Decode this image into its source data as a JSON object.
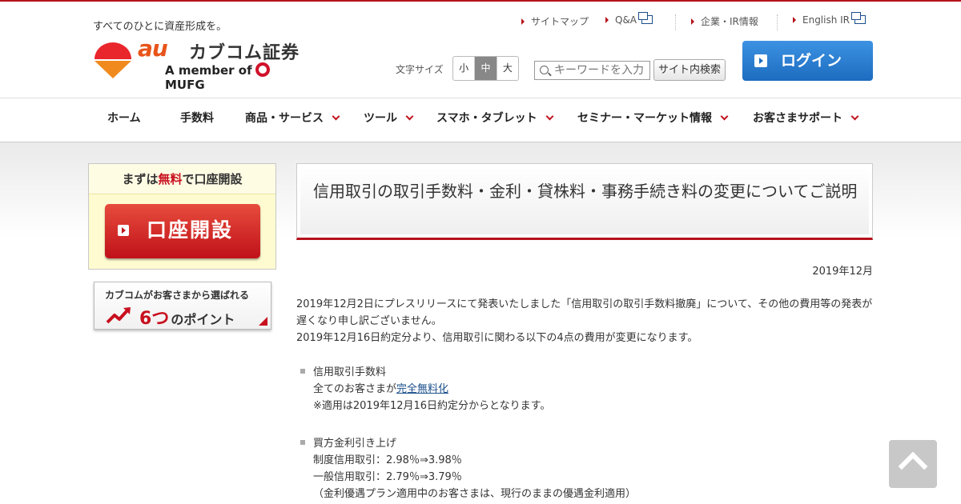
{
  "header": {
    "tagline": "すべてのひとに資産形成を。",
    "logo": {
      "au": "au",
      "brand": "カブコム証券",
      "member_prefix": "A member of",
      "member_name": "MUFG"
    },
    "utility_links": [
      {
        "label": "サイトマップ"
      },
      {
        "label": "Q&A"
      },
      {
        "label": "企業・IR情報"
      },
      {
        "label": "English IR"
      }
    ],
    "font_size": {
      "label": "文字サイズ",
      "options": [
        "小",
        "中",
        "大"
      ],
      "selected": "中"
    },
    "search": {
      "placeholder": "キーワードを入力",
      "button_label": "サイト内検索"
    },
    "login_label": "ログイン"
  },
  "nav": {
    "items": [
      {
        "label": "ホーム"
      },
      {
        "label": "手数料"
      },
      {
        "label": "商品・サービス"
      },
      {
        "label": "ツール"
      },
      {
        "label": "スマホ・タブレット"
      },
      {
        "label": "セミナー・マーケット情報"
      },
      {
        "label": "お客さまサポート"
      }
    ]
  },
  "sidebar": {
    "open_account": {
      "head_prefix": "まずは",
      "head_free": "無料",
      "head_suffix": "で口座開設",
      "button_label": "口座開設"
    },
    "points": {
      "line1": "カブコムがお客さまから選ばれる",
      "number": "6つ",
      "suffix": "のポイント"
    }
  },
  "article": {
    "title": "信用取引の取引手数料・金利・貸株料・事務手続き料の変更についてご説明",
    "date": "2019年12月",
    "intro": [
      "2019年12月2日にプレスリリースにて発表いたしました「信用取引の取引手数料撤廃」について、その他の費用等の発表が遅くなり申し訳ございません。",
      "2019年12月16日約定分より、信用取引に関わる以下の4点の費用が変更になります。"
    ],
    "items": [
      {
        "heading": "信用取引手数料",
        "line1_prefix": "全てのお客さまが",
        "line1_link": "完全無料化",
        "line2": "※適用は2019年12月16日約定分からとなります。"
      },
      {
        "heading": "買方金利引き上げ",
        "line1": "制度信用取引：2.98％⇒3.98％",
        "line2": "一般信用取引：2.79％⇒3.79％",
        "line3": "（金利優遇プラン適用中のお客さまは、現行のままの優遇金利適用）"
      }
    ]
  },
  "colors": {
    "accent_red": "#b5121b",
    "login_blue": "#1c6cc0",
    "link_blue": "#1a4f8a"
  }
}
